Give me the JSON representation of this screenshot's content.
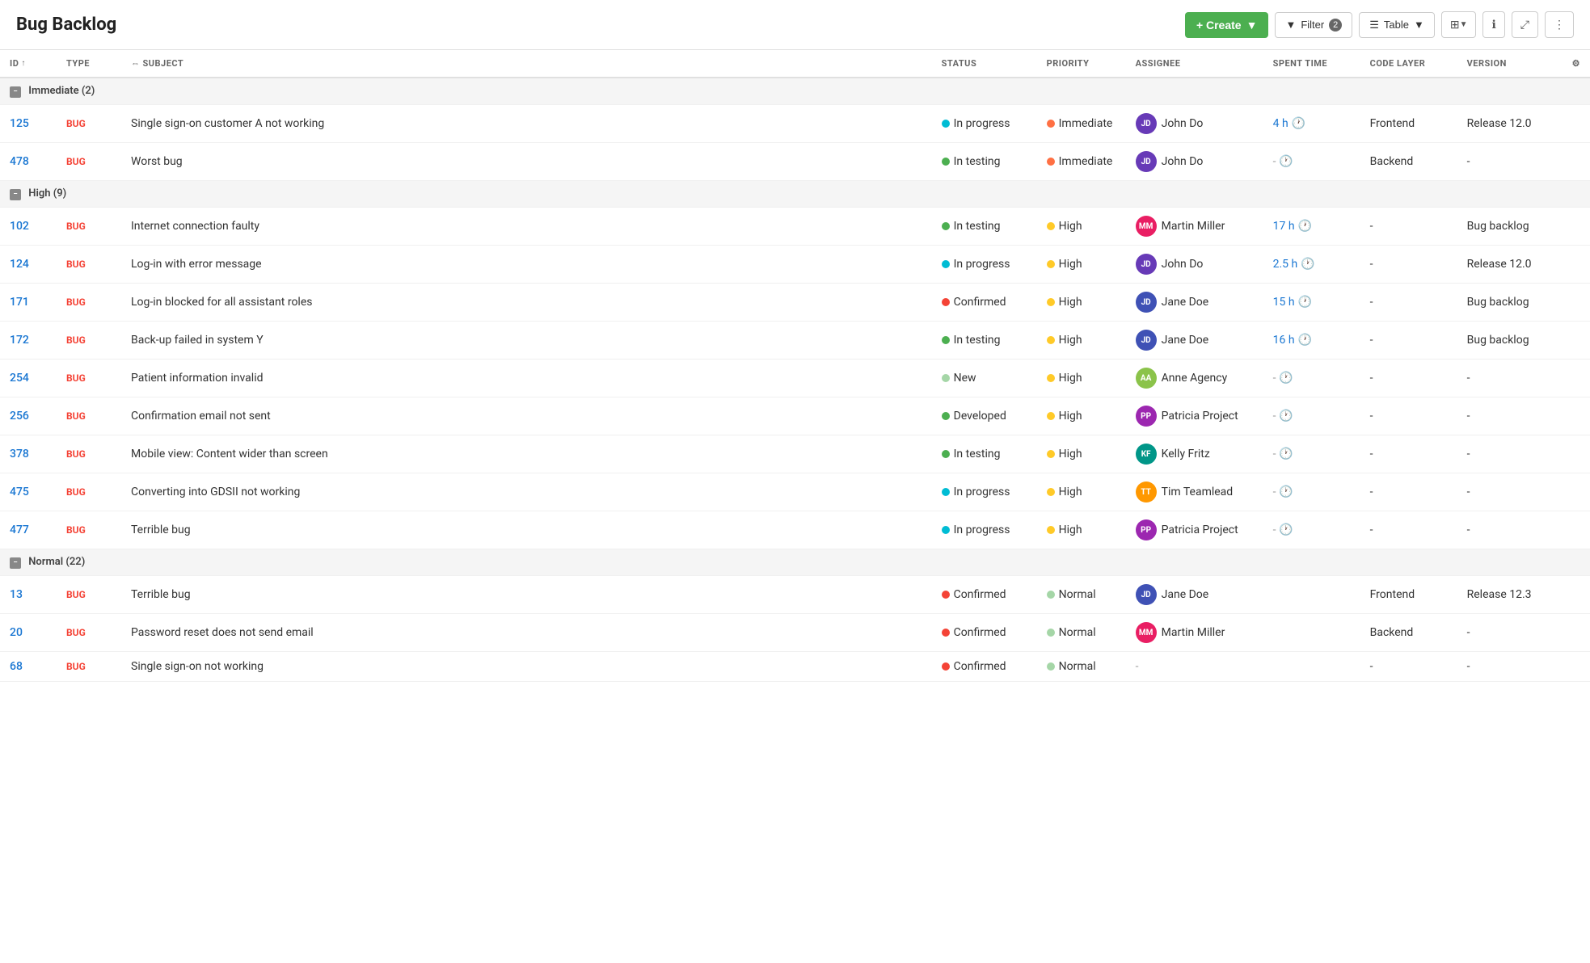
{
  "header": {
    "title": "Bug Backlog",
    "create_label": "+ Create",
    "filter_label": "Filter",
    "filter_count": "2",
    "table_label": "Table"
  },
  "columns": [
    {
      "key": "id",
      "label": "ID",
      "sortable": true
    },
    {
      "key": "type",
      "label": "TYPE",
      "sortable": false
    },
    {
      "key": "subject",
      "label": "SUBJECT",
      "sortable": true
    },
    {
      "key": "status",
      "label": "STATUS",
      "sortable": false
    },
    {
      "key": "priority",
      "label": "PRIORITY",
      "sortable": false
    },
    {
      "key": "assignee",
      "label": "ASSIGNEE",
      "sortable": false
    },
    {
      "key": "spent_time",
      "label": "SPENT TIME",
      "sortable": false
    },
    {
      "key": "code_layer",
      "label": "CODE LAYER",
      "sortable": false
    },
    {
      "key": "version",
      "label": "VERSION",
      "sortable": false
    }
  ],
  "groups": [
    {
      "name": "Immediate",
      "count": 2,
      "rows": [
        {
          "id": "125",
          "type": "BUG",
          "subject": "Single sign-on customer A not working",
          "status": "In progress",
          "status_color": "#00bcd4",
          "priority": "Immediate",
          "priority_color": "#ff7043",
          "assignee": "John Do",
          "assignee_initials": "JD",
          "assignee_color": "#673ab7",
          "spent_time": "4 h",
          "code_layer": "Frontend",
          "version": "Release 12.0"
        },
        {
          "id": "478",
          "type": "BUG",
          "subject": "Worst bug",
          "status": "In testing",
          "status_color": "#4caf50",
          "priority": "Immediate",
          "priority_color": "#ff7043",
          "assignee": "John Do",
          "assignee_initials": "JD",
          "assignee_color": "#673ab7",
          "spent_time": "-",
          "code_layer": "Backend",
          "version": "-"
        }
      ]
    },
    {
      "name": "High",
      "count": 9,
      "rows": [
        {
          "id": "102",
          "type": "BUG",
          "subject": "Internet connection faulty",
          "status": "In testing",
          "status_color": "#4caf50",
          "priority": "High",
          "priority_color": "#ffca28",
          "assignee": "Martin Miller",
          "assignee_initials": "MM",
          "assignee_color": "#e91e63",
          "spent_time": "17 h",
          "code_layer": "-",
          "version": "Bug backlog"
        },
        {
          "id": "124",
          "type": "BUG",
          "subject": "Log-in with error message",
          "status": "In progress",
          "status_color": "#00bcd4",
          "priority": "High",
          "priority_color": "#ffca28",
          "assignee": "John Do",
          "assignee_initials": "JD",
          "assignee_color": "#673ab7",
          "spent_time": "2.5 h",
          "code_layer": "-",
          "version": "Release 12.0"
        },
        {
          "id": "171",
          "type": "BUG",
          "subject": "Log-in blocked for all assistant roles",
          "status": "Confirmed",
          "status_color": "#f44336",
          "priority": "High",
          "priority_color": "#ffca28",
          "assignee": "Jane Doe",
          "assignee_initials": "JD",
          "assignee_color": "#3f51b5",
          "spent_time": "15 h",
          "code_layer": "-",
          "version": "Bug backlog"
        },
        {
          "id": "172",
          "type": "BUG",
          "subject": "Back-up failed in system Y",
          "status": "In testing",
          "status_color": "#4caf50",
          "priority": "High",
          "priority_color": "#ffca28",
          "assignee": "Jane Doe",
          "assignee_initials": "JD",
          "assignee_color": "#3f51b5",
          "spent_time": "16 h",
          "code_layer": "-",
          "version": "Bug backlog"
        },
        {
          "id": "254",
          "type": "BUG",
          "subject": "Patient information invalid",
          "status": "New",
          "status_color": "#a5d6a7",
          "priority": "High",
          "priority_color": "#ffca28",
          "assignee": "Anne Agency",
          "assignee_initials": "AA",
          "assignee_color": "#8bc34a",
          "spent_time": "-",
          "code_layer": "-",
          "version": "-"
        },
        {
          "id": "256",
          "type": "BUG",
          "subject": "Confirmation email not sent",
          "status": "Developed",
          "status_color": "#4caf50",
          "priority": "High",
          "priority_color": "#ffca28",
          "assignee": "Patricia Project",
          "assignee_initials": "PP",
          "assignee_color": "#9c27b0",
          "spent_time": "-",
          "code_layer": "-",
          "version": "-"
        },
        {
          "id": "378",
          "type": "BUG",
          "subject": "Mobile view: Content wider than screen",
          "status": "In testing",
          "status_color": "#4caf50",
          "priority": "High",
          "priority_color": "#ffca28",
          "assignee": "Kelly Fritz",
          "assignee_initials": "KF",
          "assignee_color": "#009688",
          "spent_time": "-",
          "code_layer": "-",
          "version": "-"
        },
        {
          "id": "475",
          "type": "BUG",
          "subject": "Converting into GDSII not working",
          "status": "In progress",
          "status_color": "#00bcd4",
          "priority": "High",
          "priority_color": "#ffca28",
          "assignee": "Tim Teamlead",
          "assignee_initials": "TT",
          "assignee_color": "#ff9800",
          "spent_time": "-",
          "code_layer": "-",
          "version": "-"
        },
        {
          "id": "477",
          "type": "BUG",
          "subject": "Terrible bug",
          "status": "In progress",
          "status_color": "#00bcd4",
          "priority": "High",
          "priority_color": "#ffca28",
          "assignee": "Patricia Project",
          "assignee_initials": "PP",
          "assignee_color": "#9c27b0",
          "spent_time": "-",
          "code_layer": "-",
          "version": "-"
        }
      ]
    },
    {
      "name": "Normal",
      "count": 22,
      "rows": [
        {
          "id": "13",
          "type": "BUG",
          "subject": "Terrible bug",
          "status": "Confirmed",
          "status_color": "#f44336",
          "priority": "Normal",
          "priority_color": "#a5d6a7",
          "assignee": "Jane Doe",
          "assignee_initials": "JD",
          "assignee_color": "#3f51b5",
          "spent_time": "",
          "code_layer": "Frontend",
          "version": "Release 12.3"
        },
        {
          "id": "20",
          "type": "BUG",
          "subject": "Password reset does not send email",
          "status": "Confirmed",
          "status_color": "#f44336",
          "priority": "Normal",
          "priority_color": "#a5d6a7",
          "assignee": "Martin Miller",
          "assignee_initials": "MM",
          "assignee_color": "#e91e63",
          "spent_time": "",
          "code_layer": "Backend",
          "version": "-"
        },
        {
          "id": "68",
          "type": "BUG",
          "subject": "Single sign-on not working",
          "status": "Confirmed",
          "status_color": "#f44336",
          "priority": "Normal",
          "priority_color": "#a5d6a7",
          "assignee": "-",
          "assignee_initials": "",
          "assignee_color": "",
          "spent_time": "",
          "code_layer": "-",
          "version": "-"
        }
      ]
    }
  ]
}
